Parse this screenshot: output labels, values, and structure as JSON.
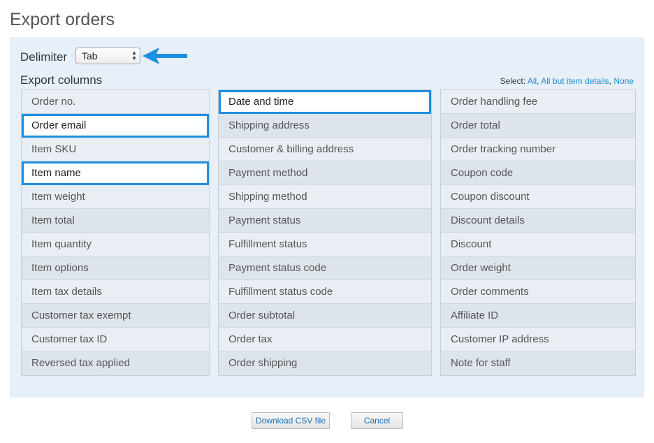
{
  "page": {
    "title": "Export orders"
  },
  "delimiter": {
    "label": "Delimiter",
    "value": "Tab"
  },
  "columns": {
    "label": "Export columns",
    "select": {
      "prefix": "Select:",
      "all": "All",
      "all_but": "All but item details",
      "none": "None"
    },
    "col1": [
      {
        "label": "Order no.",
        "selected": false
      },
      {
        "label": "Order email",
        "selected": true
      },
      {
        "label": "Item SKU",
        "selected": false
      },
      {
        "label": "Item name",
        "selected": true
      },
      {
        "label": "Item weight",
        "selected": false
      },
      {
        "label": "Item total",
        "selected": false
      },
      {
        "label": "Item quantity",
        "selected": false
      },
      {
        "label": "Item options",
        "selected": false
      },
      {
        "label": "Item tax details",
        "selected": false
      },
      {
        "label": "Customer tax exempt",
        "selected": false
      },
      {
        "label": "Customer tax ID",
        "selected": false
      },
      {
        "label": "Reversed tax applied",
        "selected": false
      }
    ],
    "col2": [
      {
        "label": "Date and time",
        "selected": true
      },
      {
        "label": "Shipping address",
        "selected": false
      },
      {
        "label": "Customer & billing address",
        "selected": false
      },
      {
        "label": "Payment method",
        "selected": false
      },
      {
        "label": "Shipping method",
        "selected": false
      },
      {
        "label": "Payment status",
        "selected": false
      },
      {
        "label": "Fulfillment status",
        "selected": false
      },
      {
        "label": "Payment status code",
        "selected": false
      },
      {
        "label": "Fulfillment status code",
        "selected": false
      },
      {
        "label": "Order subtotal",
        "selected": false
      },
      {
        "label": "Order tax",
        "selected": false
      },
      {
        "label": "Order shipping",
        "selected": false
      }
    ],
    "col3": [
      {
        "label": "Order handling fee",
        "selected": false
      },
      {
        "label": "Order total",
        "selected": false
      },
      {
        "label": "Order tracking number",
        "selected": false
      },
      {
        "label": "Coupon code",
        "selected": false
      },
      {
        "label": "Coupon discount",
        "selected": false
      },
      {
        "label": "Discount details",
        "selected": false
      },
      {
        "label": "Discount",
        "selected": false
      },
      {
        "label": "Order weight",
        "selected": false
      },
      {
        "label": "Order comments",
        "selected": false
      },
      {
        "label": "Affiliate ID",
        "selected": false
      },
      {
        "label": "Customer IP address",
        "selected": false
      },
      {
        "label": "Note for staff",
        "selected": false
      }
    ]
  },
  "buttons": {
    "download": "Download CSV file",
    "cancel": "Cancel"
  },
  "colors": {
    "accent": "#1e8fe0",
    "link": "#1a8fd0",
    "panel": "#e7eff8"
  }
}
